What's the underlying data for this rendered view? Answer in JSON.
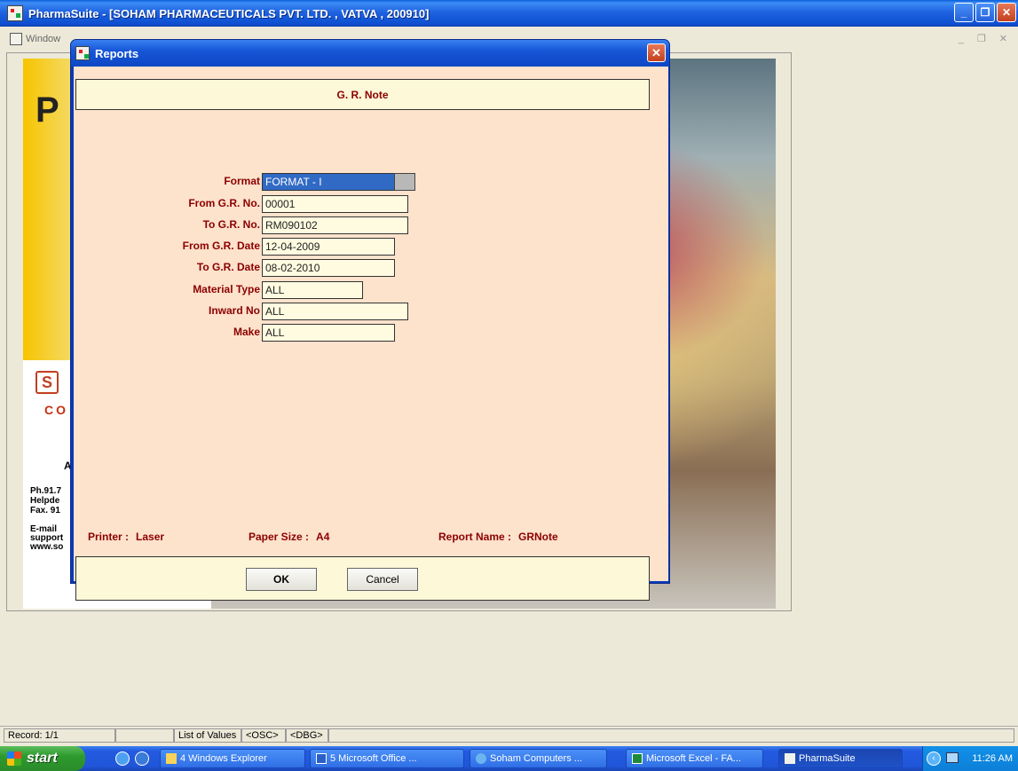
{
  "app": {
    "title": "PharmaSuite - [SOHAM PHARMACEUTICALS PVT. LTD. , VATVA , 200910]",
    "menu_window": "Window"
  },
  "splash": {
    "big_letter": "P",
    "logo_letter": "S",
    "co_text": "CO",
    "city_fragment": "Ahr",
    "contact_lines": [
      "Ph.91.7",
      "Helpde",
      "Fax. 91"
    ],
    "email_lines": [
      "E-mail",
      "support",
      "www.so"
    ]
  },
  "dialog": {
    "title": "Reports",
    "close_glyph": "✕",
    "header": "G. R. Note",
    "fields": [
      {
        "label": "Format",
        "value": "FORMAT - I",
        "selected": true,
        "has_lov": true
      },
      {
        "label": "From G.R. No.",
        "value": "00001"
      },
      {
        "label": "To G.R. No.",
        "value": "RM090102"
      },
      {
        "label": "From G.R. Date",
        "value": "12-04-2009"
      },
      {
        "label": "To G.R. Date",
        "value": "08-02-2010"
      },
      {
        "label": "Material Type",
        "value": "ALL"
      },
      {
        "label": "Inward No",
        "value": "ALL"
      },
      {
        "label": "Make",
        "value": "ALL"
      }
    ],
    "info": {
      "printer_label": "Printer :",
      "printer_value": "Laser",
      "paper_label": "Paper Size :",
      "paper_value": "A4",
      "report_label": "Report Name :",
      "report_value": "GRNote"
    },
    "buttons": {
      "ok_label": "OK",
      "cancel_label": "Cancel"
    }
  },
  "statusbar": {
    "record": "Record: 1/1",
    "blank": "",
    "lov": "List of Values",
    "osc": "<OSC>",
    "dbg": "<DBG>"
  },
  "taskbar": {
    "start": "start",
    "tasks": [
      {
        "label": "4 Windows Explorer",
        "icon": "folder-icon"
      },
      {
        "label": "5 Microsoft Office ...",
        "icon": "word-icon"
      },
      {
        "label": "Soham Computers ...",
        "icon": "ie-icon"
      },
      {
        "label": "Microsoft Excel - FA...",
        "icon": "excel-icon"
      },
      {
        "label": "PharmaSuite",
        "icon": "app-icon",
        "active": true
      }
    ],
    "clock": "11:26 AM"
  }
}
